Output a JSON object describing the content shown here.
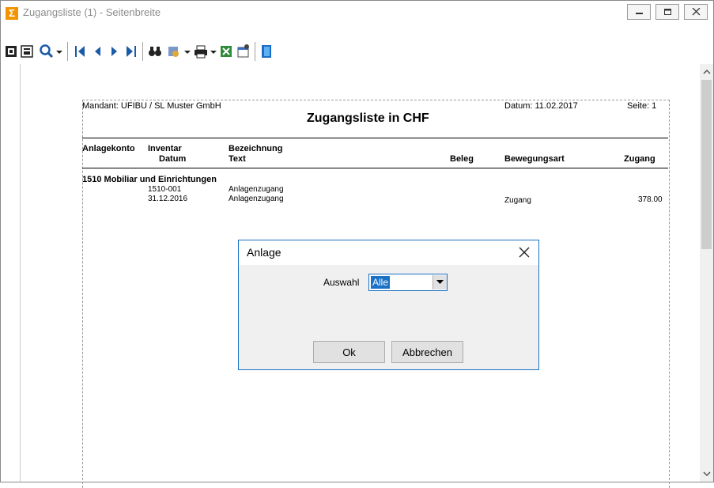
{
  "window": {
    "title": "Zugangsliste (1) - Seitenbreite"
  },
  "report": {
    "mandant": "Mandant:  UFIBU  /  SL Muster GmbH",
    "datum": "Datum:  11.02.2017",
    "seite": "Seite:  1",
    "title": "Zugangsliste in CHF",
    "headers": {
      "anlagekonto": "Anlagekonto",
      "inventar": "Inventar",
      "datum": "Datum",
      "bezeichnung": "Bezeichnung",
      "text": "Text",
      "beleg": "Beleg",
      "bewegungsart": "Bewegungsart",
      "zugang": "Zugang"
    },
    "group": "1510   Mobiliar und Einrichtungen",
    "rows": [
      {
        "inventar": "1510-001",
        "bezeichnung": "Anlagenzugang",
        "bewegungsart": "",
        "zugang": ""
      },
      {
        "inventar": "31.12.2016",
        "bezeichnung": "Anlagenzugang",
        "bewegungsart": "Zugang",
        "zugang": "378.00"
      }
    ]
  },
  "dialog": {
    "title": "Anlage",
    "auswahl_label": "Auswahl",
    "auswahl_value": "Alle",
    "ok_label": "Ok",
    "cancel_label": "Abbrechen"
  },
  "colors": {
    "accent": "#1a72c6",
    "app_icon": "#f29400"
  }
}
